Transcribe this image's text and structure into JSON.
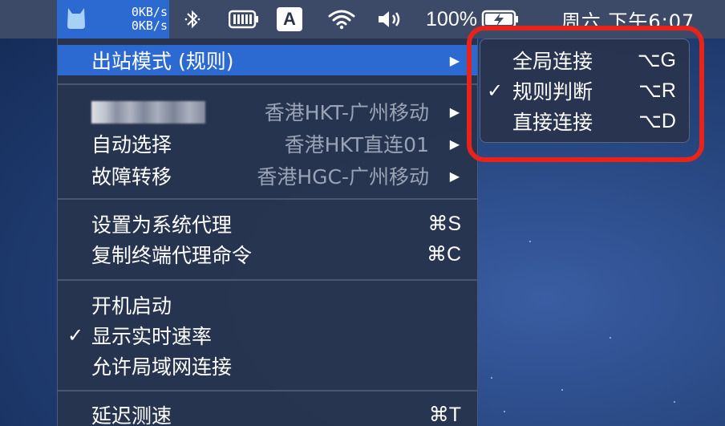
{
  "menubar": {
    "speed_up": "0KB/s",
    "speed_down": "0KB/s",
    "input_method": "A",
    "battery_percent": "100%",
    "clock": "周六 下午6:07",
    "icons": [
      "cat-icon",
      "bluetooth-icon",
      "keyboard-battery-icon",
      "input-source-icon",
      "wifi-icon",
      "volume-icon",
      "battery-charging-icon"
    ]
  },
  "menu": {
    "outbound_mode": "出站模式 (规则)",
    "proxy_group_value": "香港HKT-广州移动",
    "auto_select": {
      "label": "自动选择",
      "value": "香港HKT直连01"
    },
    "failover": {
      "label": "故障转移",
      "value": "香港HGC-广州移动"
    },
    "set_system_proxy": {
      "label": "设置为系统代理",
      "shortcut": "⌘S"
    },
    "copy_terminal": {
      "label": "复制终端代理命令",
      "shortcut": "⌘C"
    },
    "launch_at_login": {
      "label": "开机启动"
    },
    "show_speed": {
      "label": "显示实时速率",
      "checked": true,
      "check_mark": "✓"
    },
    "allow_lan": {
      "label": "允许局域网连接"
    },
    "latency_test": {
      "label": "延迟测速",
      "shortcut": "⌘T"
    },
    "arrow": "▶"
  },
  "submenu": {
    "items": [
      {
        "label": "全局连接",
        "shortcut": "⌥G",
        "checked": false
      },
      {
        "label": "规则判断",
        "shortcut": "⌥R",
        "checked": true,
        "check_mark": "✓"
      },
      {
        "label": "直接连接",
        "shortcut": "⌥D",
        "checked": false
      }
    ]
  },
  "colors": {
    "highlight": "#2c69d1",
    "menu_bg": "#28344e",
    "annotation": "#e8231b",
    "desktop": "#1b3566"
  }
}
